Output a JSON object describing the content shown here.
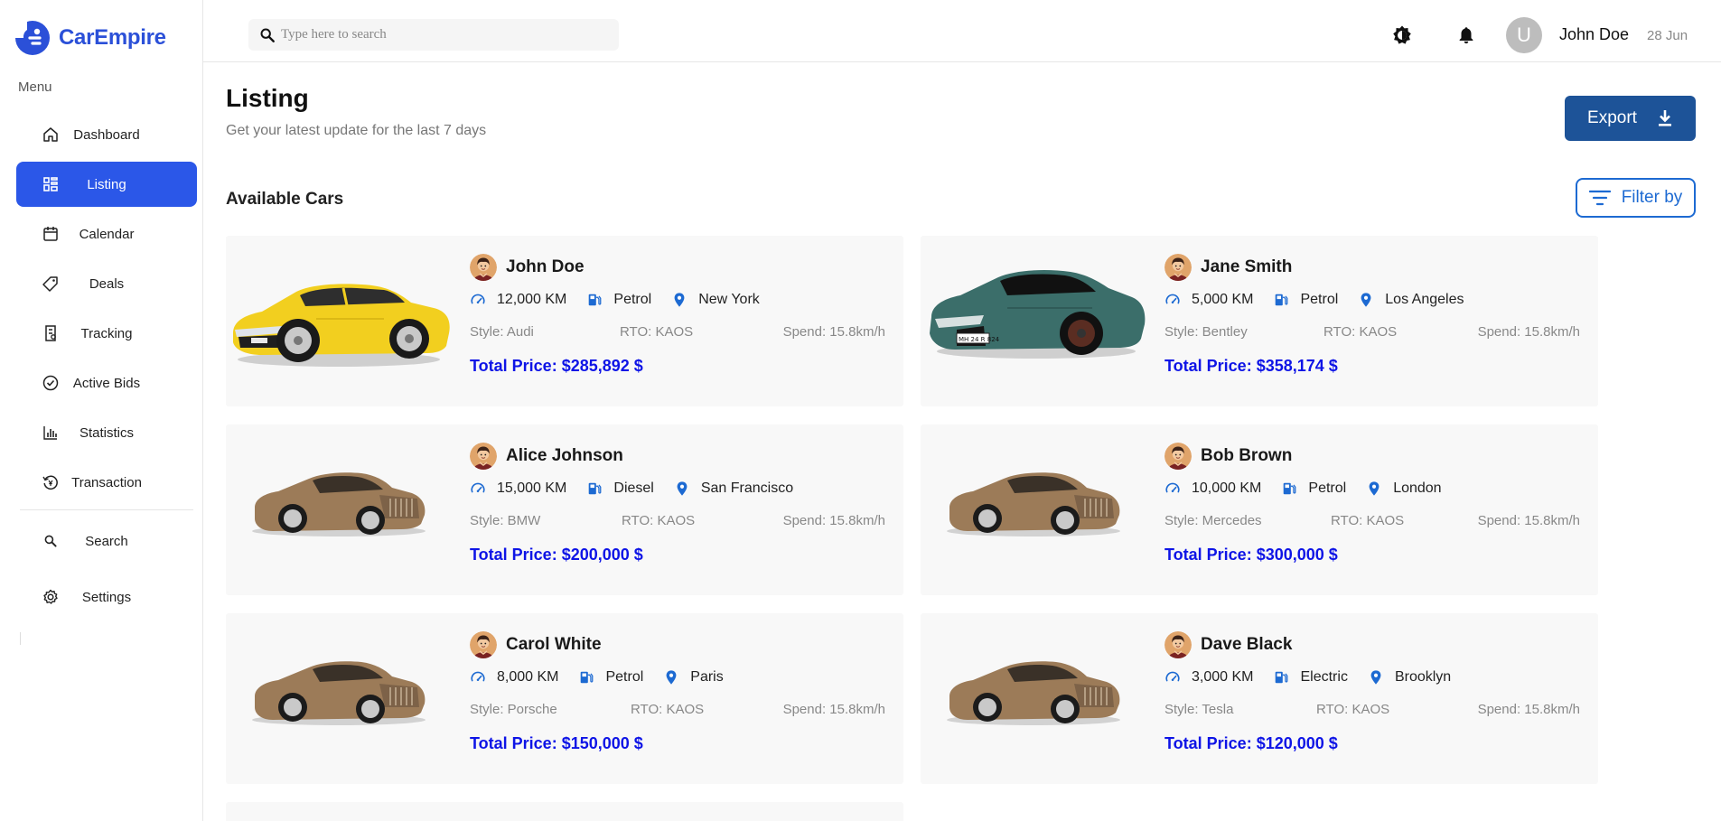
{
  "brand": {
    "name": "CarEmpire"
  },
  "sidebar": {
    "menu_label": "Menu",
    "items": [
      {
        "label": "Dashboard",
        "icon": "home-icon",
        "active": false
      },
      {
        "label": "Listing",
        "icon": "grid-icon",
        "active": true
      },
      {
        "label": "Calendar",
        "icon": "calendar-icon",
        "active": false
      },
      {
        "label": "Deals",
        "icon": "tag-icon",
        "active": false
      },
      {
        "label": "Tracking",
        "icon": "document-icon",
        "active": false
      },
      {
        "label": "Active Bids",
        "icon": "check-circle-icon",
        "active": false
      },
      {
        "label": "Statistics",
        "icon": "bar-chart-icon",
        "active": false
      },
      {
        "label": "Transaction",
        "icon": "currency-cycle-icon",
        "active": false
      }
    ],
    "bottom_items": [
      {
        "label": "Search",
        "icon": "search-icon"
      },
      {
        "label": "Settings",
        "icon": "gear-icon"
      }
    ]
  },
  "header": {
    "search_placeholder": "Type here to search",
    "user": {
      "initial": "U",
      "name": "John Doe",
      "date": "28 Jun"
    }
  },
  "main": {
    "title": "Listing",
    "subtitle": "Get your latest update for the last 7 days",
    "export_label": "Export",
    "section_title": "Available Cars",
    "filter_label": "Filter by"
  },
  "colors": {
    "accent": "#2b57e8",
    "export": "#1d5398",
    "price": "#0e14e6",
    "icon_blue": "#1d6ad2"
  },
  "cars": [
    {
      "owner": "John Doe",
      "km": "12,000 KM",
      "fuel": "Petrol",
      "location": "New York",
      "style": "Style: Audi",
      "rto": "RTO: KAOS",
      "spend": "Spend: 15.8km/h",
      "price": "Total Price: $285,892 $",
      "car": "yellow-sedan"
    },
    {
      "owner": "Jane Smith",
      "km": "5,000 KM",
      "fuel": "Petrol",
      "location": "Los Angeles",
      "style": "Style: Bentley",
      "rto": "RTO: KAOS",
      "spend": "Spend: 15.8km/h",
      "price": "Total Price: $358,174 $",
      "car": "green-sports",
      "plate": "MH 24 R 824"
    },
    {
      "owner": "Alice Johnson",
      "km": "15,000 KM",
      "fuel": "Diesel",
      "location": "San Francisco",
      "style": "Style: BMW",
      "rto": "RTO: KAOS",
      "spend": "Spend: 15.8km/h",
      "price": "Total Price: $200,000 $",
      "car": "bronze-sedan"
    },
    {
      "owner": "Bob Brown",
      "km": "10,000 KM",
      "fuel": "Petrol",
      "location": "London",
      "style": "Style: Mercedes",
      "rto": "RTO: KAOS",
      "spend": "Spend: 15.8km/h",
      "price": "Total Price: $300,000 $",
      "car": "bronze-sedan"
    },
    {
      "owner": "Carol White",
      "km": "8,000 KM",
      "fuel": "Petrol",
      "location": "Paris",
      "style": "Style: Porsche",
      "rto": "RTO: KAOS",
      "spend": "Spend: 15.8km/h",
      "price": "Total Price: $150,000 $",
      "car": "bronze-sedan"
    },
    {
      "owner": "Dave Black",
      "km": "3,000 KM",
      "fuel": "Electric",
      "location": "Brooklyn",
      "style": "Style: Tesla",
      "rto": "RTO: KAOS",
      "spend": "Spend: 15.8km/h",
      "price": "Total Price: $120,000 $",
      "car": "bronze-sedan"
    }
  ]
}
